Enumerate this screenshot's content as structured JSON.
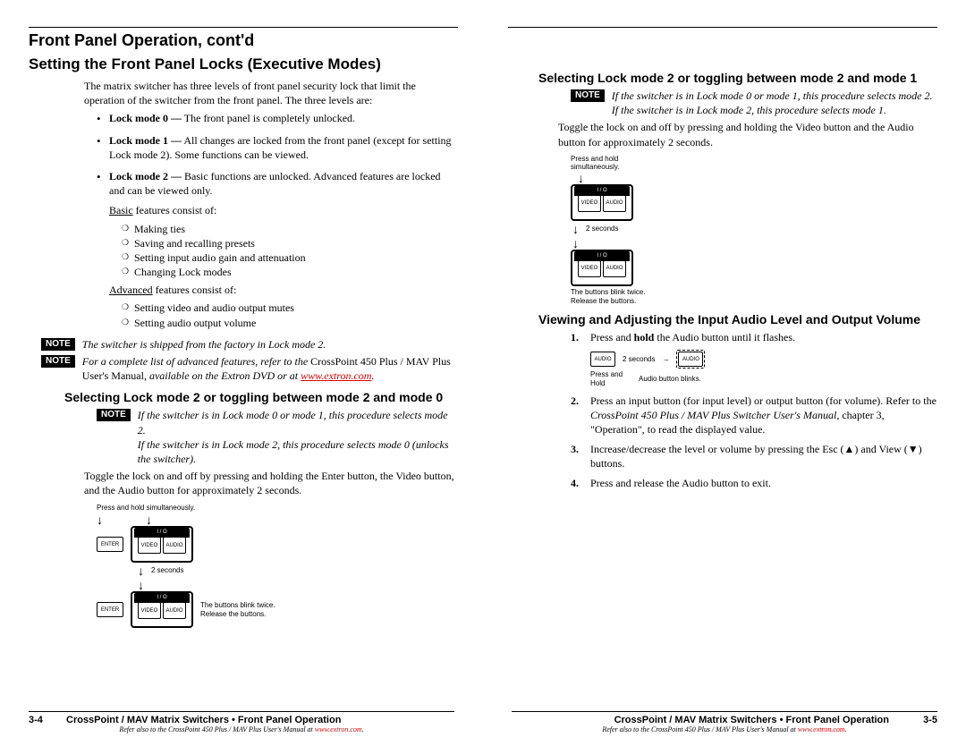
{
  "leftCol": {
    "h1": "Front Panel Operation, cont'd",
    "h2": "Setting the Front Panel Locks (Executive Modes)",
    "intro": "The matrix switcher has three levels of front panel security lock that limit the operation of the switcher from the front panel. The three levels are:",
    "mode0b": "Lock mode 0 —",
    "mode0": " The front panel is completely unlocked.",
    "mode1b": "Lock mode 1 —",
    "mode1": " All changes are locked from the front panel (except for setting Lock mode 2). Some functions can be viewed.",
    "mode2b": "Lock mode 2 —",
    "mode2": " Basic functions are unlocked. Advanced features are locked and can be viewed only.",
    "basicLabel": "Basic",
    "basicTail": " features consist of:",
    "basic1": "Making ties",
    "basic2": "Saving and recalling presets",
    "basic3": "Setting input audio gain and attenuation",
    "basic4": "Changing Lock modes",
    "advLabel": "Advanced",
    "advTail": " features consist of:",
    "adv1": "Setting video and audio output mutes",
    "adv2": "Setting audio output volume",
    "note1": "The switcher is shipped from the factory in Lock mode 2.",
    "note2a": "For a complete list of advanced features, refer to the ",
    "note2b": "CrossPoint 450 Plus / MAV Plus User's Manual",
    "note2c": ", available on the Extron DVD or at ",
    "note2link": "www.extron.com",
    "note2d": ".",
    "h3a": "Selecting Lock mode 2 or toggling between mode 2 and mode 0",
    "note3a": "If the switcher is in Lock mode 0 or mode 1, this procedure selects mode 2.",
    "note3b": "If the switcher is in Lock mode 2, this procedure selects mode 0 (unlocks the switcher).",
    "togglePara": "Toggle the lock on and off by pressing and holding the Enter button, the Video button, and the Audio button for approximately 2 seconds.",
    "figCap1": "Press and hold simultaneously.",
    "figBtnEnter": "ENTER",
    "figBtnVideo": "VIDEO",
    "figBtnAudio": "AUDIO",
    "figIO": "I / O",
    "fig2sec": "2 seconds",
    "figRelease": "The buttons blink twice.\nRelease the buttons.",
    "footerPg": "3-4",
    "footerMain": "CrossPoint / MAV Matrix Switchers • Front Panel Operation",
    "footerSub1": "Refer also to the CrossPoint 450 Plus / MAV Plus User's Manual at ",
    "footerSubLink": "www.extron.com",
    "footerSub2": "."
  },
  "rightCol": {
    "h3a": "Selecting Lock mode 2 or toggling between mode 2 and mode 1",
    "note1a": "If the switcher is in Lock mode 0 or mode 1, this procedure selects mode 2.",
    "note1b": "If the switcher is in Lock mode 2, this procedure selects mode 1.",
    "togglePara": "Toggle the lock on and off by pressing and holding the Video button and the Audio button for approximately 2 seconds.",
    "figCap1": "Press and hold\nsimultaneously.",
    "figBtnVideo": "VIDEO",
    "figBtnAudio": "AUDIO",
    "figIO": "I / O",
    "fig2sec": "2 seconds",
    "figRelease": "The buttons blink twice.\nRelease the buttons.",
    "h3b": "Viewing and Adjusting the Input Audio Level and Output Volume",
    "step1a": "Press and ",
    "step1b": "hold",
    "step1c": " the Audio button until it flashes.",
    "figS1a": "AUDIO",
    "figS1b": "2 seconds",
    "figS1c": "Press and\nHold",
    "figS1d": "Audio button blinks.",
    "step2a": "Press an input button (for input level) or output button (for volume). Refer to the ",
    "step2b": "CrossPoint 450 Plus / MAV Plus Switcher User's Manual",
    "step2c": ", chapter 3, \"Operation\", to read the displayed value.",
    "step3": "Increase/decrease the level or volume by pressing the Esc (▲) and View (▼) buttons.",
    "step4": "Press and release the Audio button to exit.",
    "footerMain": "CrossPoint / MAV Matrix Switchers • Front Panel Operation",
    "footerPg": "3-5",
    "footerSub1": "Refer also to the CrossPoint 450 Plus / MAV Plus User's Manual at ",
    "footerSubLink": "www.extron.com",
    "footerSub2": "."
  },
  "noteLabel": "NOTE"
}
